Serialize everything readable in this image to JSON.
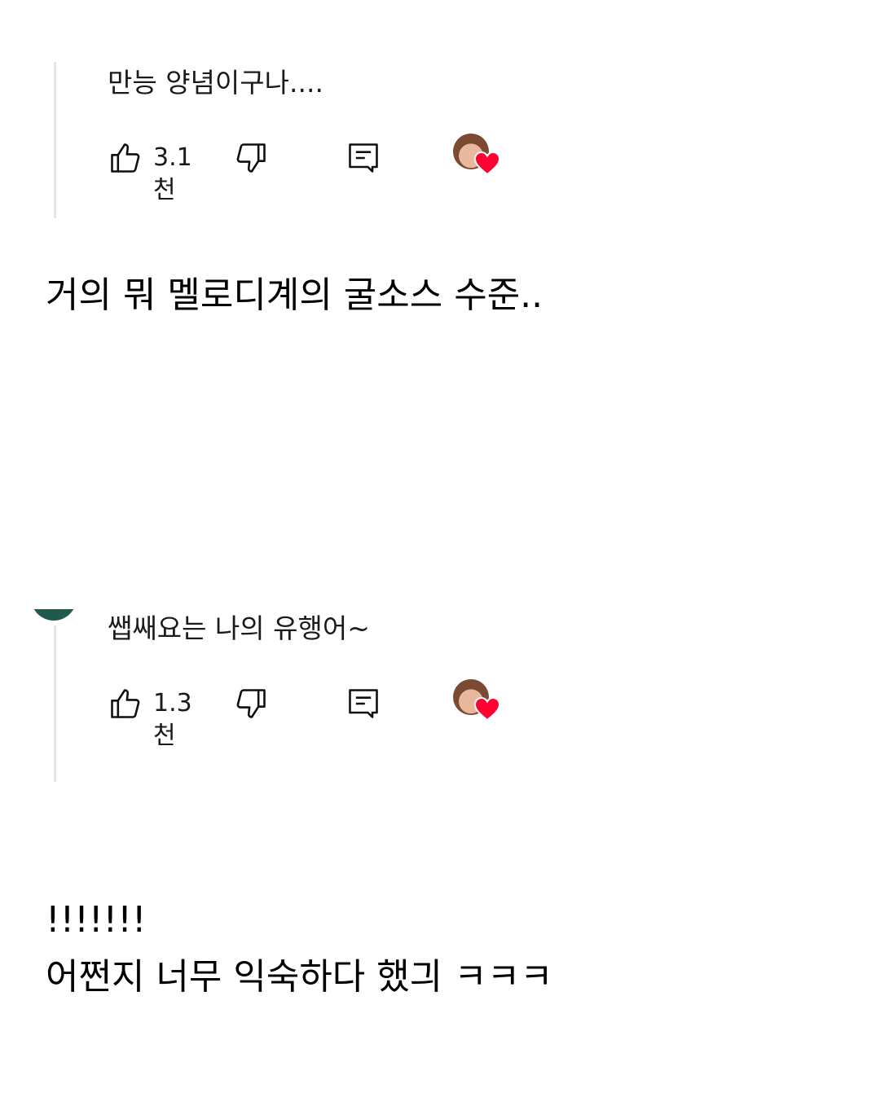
{
  "thread1": {
    "reply_text": "만능 양념이구나....",
    "like_count": "3.1천"
  },
  "caption1": "거의 뭐 멜로디계의 굴소스 수준..",
  "thread2": {
    "reply_text": "쌥쌔요는 나의 유행어~",
    "like_count": "1.3천"
  },
  "caption2": {
    "line1": "!!!!!!!",
    "line2": "어쩐지 너무 익숙하다 했긔 ㅋㅋㅋ"
  },
  "icons": {
    "like": "thumbs-up-icon",
    "dislike": "thumbs-down-icon",
    "reply": "reply-comment-icon",
    "creator_heart": "creator-heart-badge",
    "heart_color": "#ff0033"
  }
}
